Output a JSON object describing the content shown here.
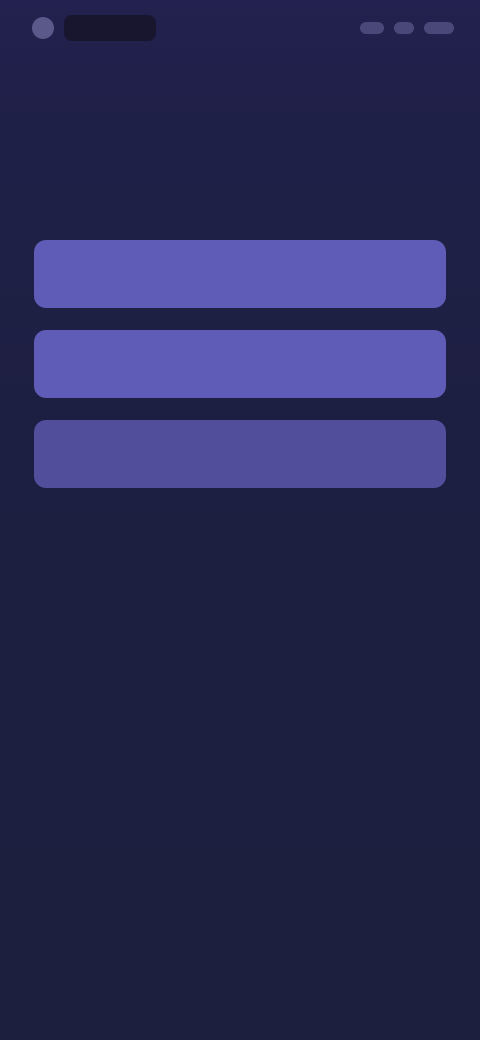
{
  "status_bar": {
    "left": [
      "carrier-mark",
      "carrier-bar"
    ],
    "right": [
      "signal-icon",
      "wifi-icon",
      "battery-icon"
    ]
  },
  "page": {
    "title": "",
    "subtitle": ""
  },
  "options": [
    {
      "label": "",
      "style": "primary"
    },
    {
      "label": "",
      "style": "primary"
    },
    {
      "label": "",
      "style": "secondary"
    }
  ],
  "colors": {
    "background": "#1d1f3d",
    "option_primary": "#5e5cb6",
    "option_secondary": "#5653a3",
    "title_text": "#d9d8f2",
    "subtitle_text": "#8c8bb6"
  }
}
